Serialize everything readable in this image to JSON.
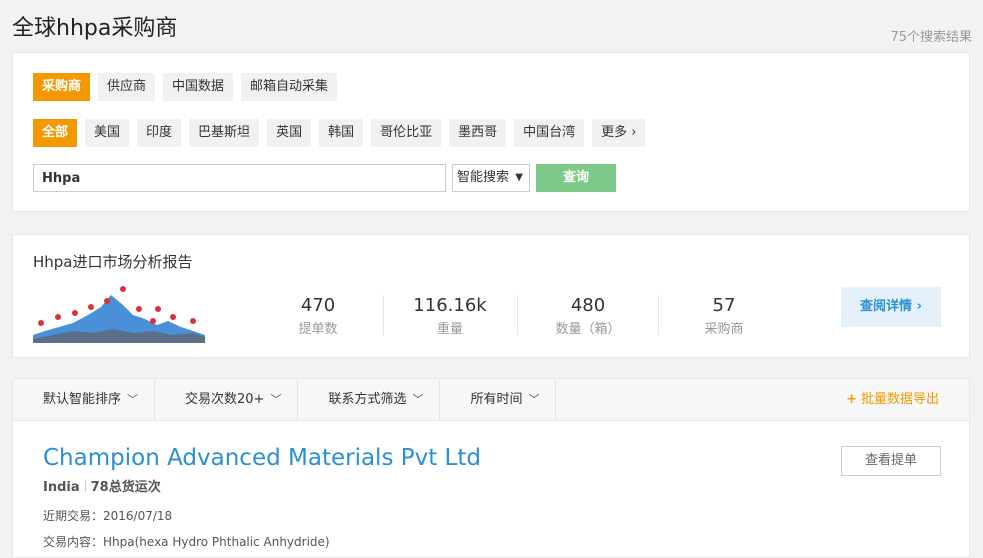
{
  "header": {
    "title": "全球hhpa采购商",
    "result_count": "75个搜索结果"
  },
  "filters": {
    "categories": [
      {
        "label": "采购商",
        "active": true
      },
      {
        "label": "供应商",
        "active": false
      },
      {
        "label": "中国数据",
        "active": false
      },
      {
        "label": "邮箱自动采集",
        "active": false
      }
    ],
    "countries": [
      {
        "label": "全部",
        "active": true
      },
      {
        "label": "美国",
        "active": false
      },
      {
        "label": "印度",
        "active": false
      },
      {
        "label": "巴基斯坦",
        "active": false
      },
      {
        "label": "英国",
        "active": false
      },
      {
        "label": "韩国",
        "active": false
      },
      {
        "label": "哥伦比亚",
        "active": false
      },
      {
        "label": "墨西哥",
        "active": false
      },
      {
        "label": "中国台湾",
        "active": false
      },
      {
        "label": "更多 ›",
        "active": false
      }
    ]
  },
  "search": {
    "value": "Hhpa",
    "mode": "智能搜索",
    "button": "查询"
  },
  "analysis": {
    "title": "Hhpa进口市场分析报告",
    "stats": [
      {
        "value": "470",
        "label": "提单数"
      },
      {
        "value": "116.16k",
        "label": "重量"
      },
      {
        "value": "480",
        "label": "数量（箱）"
      },
      {
        "value": "57",
        "label": "采购商"
      }
    ],
    "detail_button": "查阅详情 ›"
  },
  "sort_bar": {
    "items": [
      "默认智能排序",
      "交易次数20+",
      "联系方式筛选",
      "所有时间"
    ],
    "export": "批量数据导出"
  },
  "company": {
    "name": "Champion Advanced Materials Pvt Ltd",
    "country": "India",
    "shipments": "78总货运次",
    "view_button": "查看提单",
    "recent_label": "近期交易：",
    "recent_date": "2016/07/18",
    "content_label": "交易内容：",
    "content": "Hhpa(hexa Hydro Phthalic Anhydride)"
  },
  "colors": {
    "accent": "#f39800",
    "link": "#2b8fd3",
    "search_button": "#7dc98a"
  }
}
